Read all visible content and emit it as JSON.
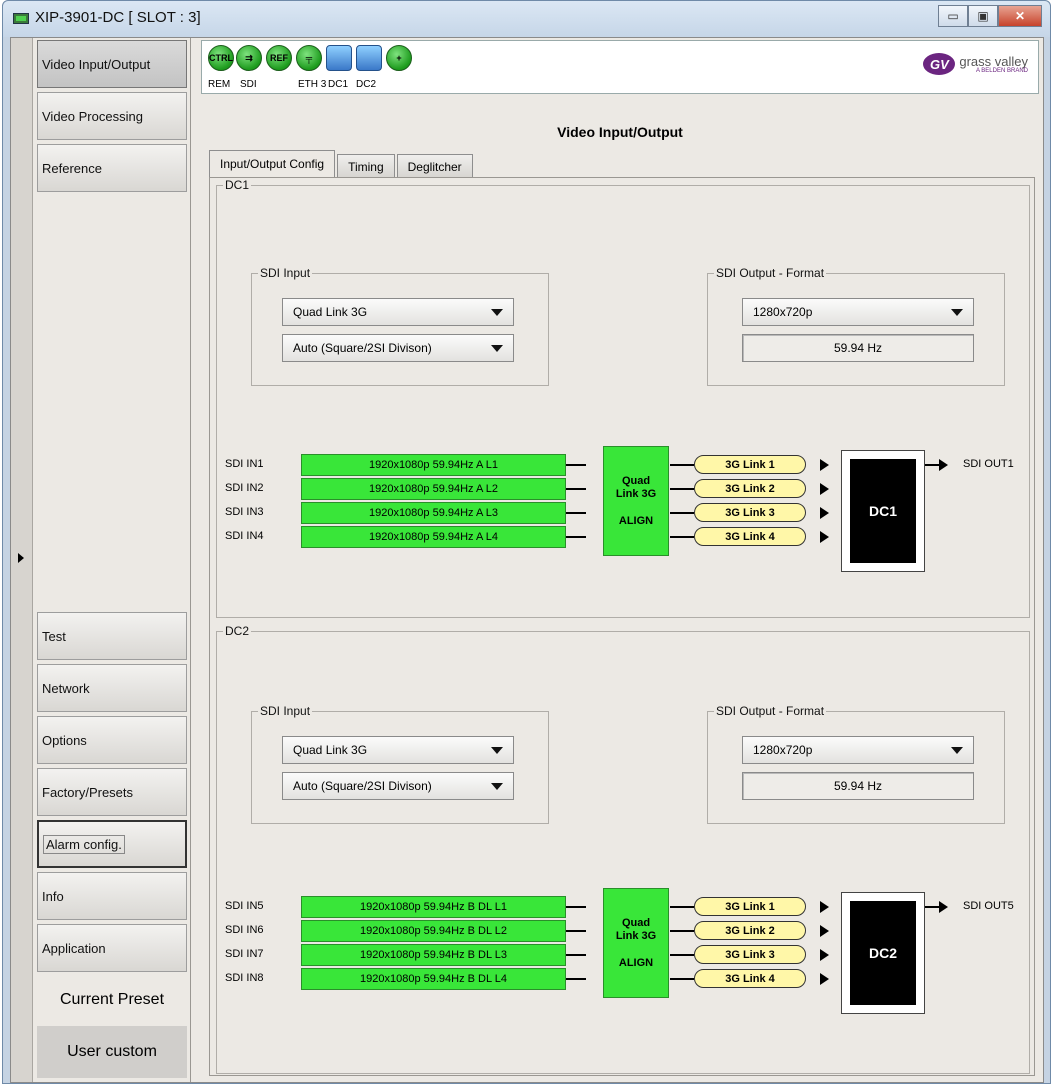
{
  "window": {
    "title": "XIP-3901-DC [ SLOT : 3]",
    "minimize": "▭",
    "maximize": "▣",
    "close": "✕"
  },
  "nav": {
    "items": [
      "Video Input/Output",
      "Video Processing",
      "Reference",
      "Test",
      "Network",
      "Options",
      "Factory/Presets",
      "Alarm config.",
      "Info",
      "Application"
    ],
    "preset_label": "Current Preset",
    "preset_value": "User custom"
  },
  "toolbar": {
    "icons": [
      {
        "name": "ctrl",
        "text": "CTRL",
        "label": "REM"
      },
      {
        "name": "sdi",
        "text": "⇉",
        "label": "SDI"
      },
      {
        "name": "ref",
        "text": "REF",
        "label": ""
      },
      {
        "name": "eth",
        "text": "╤",
        "label": "ETH 3"
      },
      {
        "name": "dc1",
        "text": "",
        "label": "DC1"
      },
      {
        "name": "dc2",
        "text": "",
        "label": "DC2"
      },
      {
        "name": "plus",
        "text": "+",
        "label": ""
      }
    ],
    "logo_badge": "GV",
    "logo_text": "grass valley",
    "logo_sub": "A BELDEN BRAND"
  },
  "page": {
    "title": "Video Input/Output",
    "tabs": [
      "Input/Output Config",
      "Timing",
      "Deglitcher"
    ]
  },
  "dc1": {
    "legend": "DC1",
    "sdi_input_legend": "SDI Input",
    "input_mode": "Quad Link 3G",
    "division": "Auto (Square/2SI Divison)",
    "output_legend": "SDI Output - Format",
    "output_format": "1280x720p",
    "output_rate": "59.94 Hz",
    "inputs": [
      {
        "label": "SDI IN1",
        "signal": "1920x1080p 59.94Hz A L1"
      },
      {
        "label": "SDI IN2",
        "signal": "1920x1080p 59.94Hz A L2"
      },
      {
        "label": "SDI IN3",
        "signal": "1920x1080p 59.94Hz A L3"
      },
      {
        "label": "SDI IN4",
        "signal": "1920x1080p 59.94Hz A L4"
      }
    ],
    "align_line1": "Quad",
    "align_line2": "Link 3G",
    "align_line3": "ALIGN",
    "links": [
      "3G Link 1",
      "3G Link 2",
      "3G Link 3",
      "3G Link 4"
    ],
    "dc_label": "DC1",
    "output_label": "SDI OUT1"
  },
  "dc2": {
    "legend": "DC2",
    "sdi_input_legend": "SDI Input",
    "input_mode": "Quad Link 3G",
    "division": "Auto (Square/2SI Divison)",
    "output_legend": "SDI Output - Format",
    "output_format": "1280x720p",
    "output_rate": "59.94 Hz",
    "inputs": [
      {
        "label": "SDI IN5",
        "signal": "1920x1080p 59.94Hz B DL L1"
      },
      {
        "label": "SDI IN6",
        "signal": "1920x1080p 59.94Hz B DL L2"
      },
      {
        "label": "SDI IN7",
        "signal": "1920x1080p 59.94Hz B DL L3"
      },
      {
        "label": "SDI IN8",
        "signal": "1920x1080p 59.94Hz B DL L4"
      }
    ],
    "align_line1": "Quad",
    "align_line2": "Link 3G",
    "align_line3": "ALIGN",
    "links": [
      "3G Link 1",
      "3G Link 2",
      "3G Link 3",
      "3G Link 4"
    ],
    "dc_label": "DC2",
    "output_label": "SDI OUT5"
  },
  "colors": {
    "signal_green": "#39e639",
    "link_yellow": "#fff7a8",
    "gv_purple": "#6b2580"
  }
}
